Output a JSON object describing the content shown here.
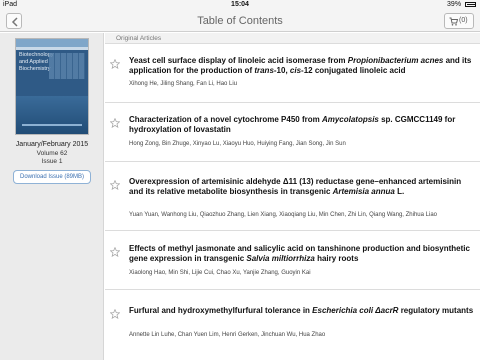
{
  "status_bar": {
    "carrier": "iPad",
    "time": "15:04",
    "battery": "39%"
  },
  "nav": {
    "title": "Table of Contents",
    "cart_count": "(0)"
  },
  "sidebar": {
    "cover_title_line1": "Biotechnology",
    "cover_title_line2": "and Applied",
    "cover_title_line3": "Biochemistry",
    "issue_date": "January/February 2015",
    "volume": "Volume 62",
    "issue": "Issue 1",
    "download_label": "Download Issue (89MB)"
  },
  "section_header": "Original Articles",
  "articles": [
    {
      "t1": "Yeast cell surface display of linoleic acid isomerase from ",
      "t1i": "Propionibacterium acnes",
      "t2": " and its application for the production of ",
      "t2i": "trans",
      "t3": "-10, ",
      "t3i": "cis",
      "t4": "-12 conjugated linoleic acid",
      "authors": "Xihong He, Jiling Shang, Fan Li, Hao Liu"
    },
    {
      "t1": "Characterization of a novel cytochrome P450 from ",
      "t1i": "Amycolatopsis",
      "t2": " sp. CGMCC1149 for hydroxylation of lovastatin",
      "authors": "Hong Zong, Bin Zhuge, Xinyao Lu, Xiaoyu Huo, Huiying Fang, Jian Song, Jin Sun"
    },
    {
      "t1": "Overexpression of artemisinic aldehyde Δ11 (13) reductase gene–enhanced artemisinin and its relative metabolite biosynthesis in transgenic ",
      "t1i": "Artemisia annua",
      "t2": " L.",
      "authors": "Yuan Yuan, Wanhong Liu, Qiaozhuo Zhang, Lien Xiang, Xiaoqiang Liu, Min Chen, Zhi Lin, Qiang Wang, Zhihua Liao"
    },
    {
      "t1": "Effects of methyl jasmonate and salicylic acid on tanshinone production and biosynthetic gene expression in transgenic ",
      "t1i": "Salvia miltiorrhiza",
      "t2": " hairy roots",
      "authors": "Xiaolong Hao, Min Shi, Lijie Cui, Chao Xu, Yanjie Zhang, Guoyin Kai"
    },
    {
      "t1": "Furfural and hydroxymethylfurfural tolerance in ",
      "t1i": "Escherichia coli ΔacrR",
      "t2": " regulatory mutants",
      "authors": "Annette Lin Luhe, Chan Yuen Lim, Henri Gerken, Jinchuan Wu, Hua Zhao"
    }
  ]
}
